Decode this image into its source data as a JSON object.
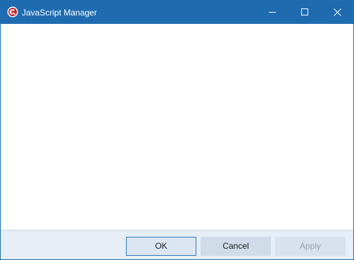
{
  "window": {
    "title": "JavaScript Manager",
    "app_icon": "app-logo-icon",
    "controls": {
      "minimize_icon": "minimize-icon",
      "maximize_icon": "maximize-icon",
      "close_icon": "close-icon"
    }
  },
  "footer": {
    "ok_label": "OK",
    "cancel_label": "Cancel",
    "apply_label": "Apply",
    "apply_disabled": true
  },
  "colors": {
    "titlebar": "#1f6bb0",
    "footer": "#e6eef7",
    "ok_border": "#2f78c0",
    "app_icon_red": "#c0272d"
  }
}
